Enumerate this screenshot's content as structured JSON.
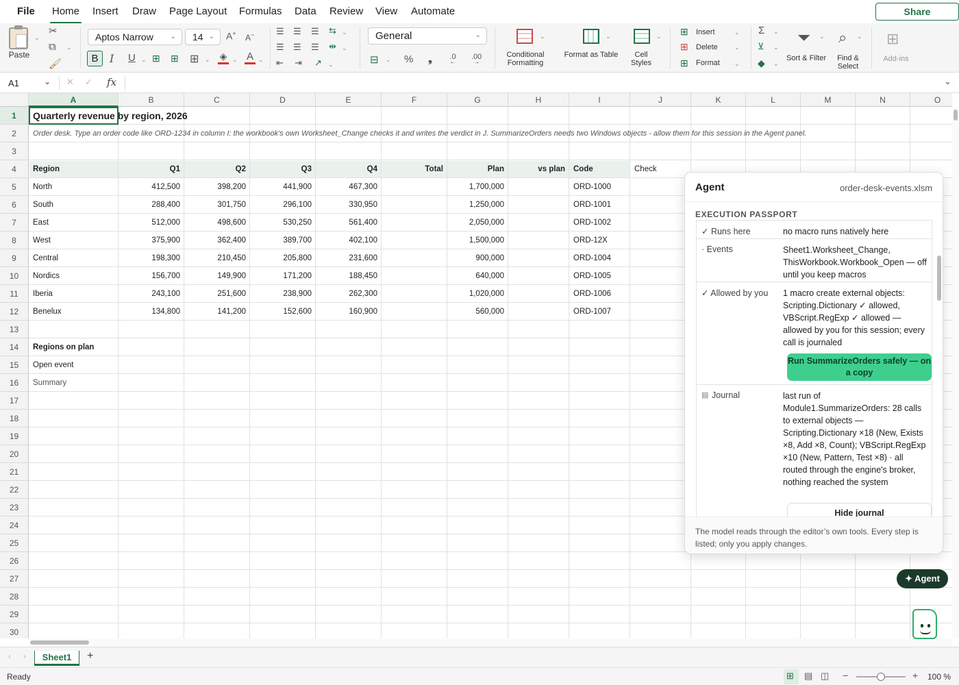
{
  "menu": {
    "file": "File",
    "tabs": [
      "Home",
      "Insert",
      "Draw",
      "Page Layout",
      "Formulas",
      "Data",
      "Review",
      "View",
      "Automate"
    ],
    "share": "Share"
  },
  "ribbon": {
    "paste": "Paste",
    "font_name": "Aptos Narrow",
    "font_size": "14",
    "number_format": "General",
    "conditional_formatting": "Conditional Formatting",
    "format_as_table": "Format as Table",
    "cell_styles": "Cell Styles",
    "insert": "Insert",
    "delete": "Delete",
    "format": "Format",
    "sort_filter": "Sort & Filter",
    "find_select": "Find & Select",
    "addins": "Add-ins",
    "bold": "B",
    "italic": "I",
    "underline": "U"
  },
  "formula_bar": {
    "name_box": "A1",
    "fx": "fx",
    "value": ""
  },
  "columns": [
    "A",
    "B",
    "C",
    "D",
    "E",
    "F",
    "G",
    "H",
    "I",
    "J",
    "K",
    "L",
    "M",
    "N",
    "O"
  ],
  "rows": [
    "1",
    "2",
    "3",
    "4",
    "5",
    "6",
    "7",
    "8",
    "9",
    "10",
    "11",
    "12",
    "13",
    "14",
    "15",
    "16",
    "17",
    "18",
    "19",
    "20",
    "21",
    "22",
    "23",
    "24",
    "25",
    "26",
    "27",
    "28",
    "29",
    "30"
  ],
  "sheet": {
    "title": "Quarterly revenue by region, 2026",
    "note": "Order desk. Type an order code like ORD-1234 in column I: the workbook's own Worksheet_Change checks it and writes the verdict in J. SummarizeOrders needs two Windows objects - allow them for this session in the Agent panel.",
    "headers": {
      "region": "Region",
      "q1": "Q1",
      "q2": "Q2",
      "q3": "Q3",
      "q4": "Q4",
      "total": "Total",
      "plan": "Plan",
      "vsplan": "vs plan",
      "code": "Code",
      "check": "Check"
    },
    "data": [
      {
        "region": "North",
        "q1": "412,500",
        "q2": "398,200",
        "q3": "441,900",
        "q4": "467,300",
        "plan": "1,700,000",
        "code": "ORD-1000"
      },
      {
        "region": "South",
        "q1": "288,400",
        "q2": "301,750",
        "q3": "296,100",
        "q4": "330,950",
        "plan": "1,250,000",
        "code": "ORD-1001"
      },
      {
        "region": "East",
        "q1": "512,000",
        "q2": "498,600",
        "q3": "530,250",
        "q4": "561,400",
        "plan": "2,050,000",
        "code": "ORD-1002"
      },
      {
        "region": "West",
        "q1": "375,900",
        "q2": "362,400",
        "q3": "389,700",
        "q4": "402,100",
        "plan": "1,500,000",
        "code": "ORD-12X"
      },
      {
        "region": "Central",
        "q1": "198,300",
        "q2": "210,450",
        "q3": "205,800",
        "q4": "231,600",
        "plan": "900,000",
        "code": "ORD-1004"
      },
      {
        "region": "Nordics",
        "q1": "156,700",
        "q2": "149,900",
        "q3": "171,200",
        "q4": "188,450",
        "plan": "640,000",
        "code": "ORD-1005"
      },
      {
        "region": "Iberia",
        "q1": "243,100",
        "q2": "251,600",
        "q3": "238,900",
        "q4": "262,300",
        "plan": "1,020,000",
        "code": "ORD-1006"
      },
      {
        "region": "Benelux",
        "q1": "134,800",
        "q2": "141,200",
        "q3": "152,600",
        "q4": "160,900",
        "plan": "560,000",
        "code": "ORD-1007"
      }
    ],
    "regions_on_plan": "Regions on plan",
    "open_event": "Open event",
    "summary": "Summary"
  },
  "agent": {
    "title": "Agent",
    "file": "order-desk-events.xlsm",
    "section": "EXECUTION PASSPORT",
    "runs_here_label": "✓ Runs here",
    "runs_here_value": "no macro runs natively here",
    "events_label": "· Events",
    "events_value": "Sheet1.Worksheet_Change, ThisWorkbook.Workbook_Open — off until you keep macros",
    "allowed_label": "✓ Allowed by you",
    "allowed_value": "1 macro create external objects: Scripting.Dictionary ✓ allowed, VBScript.RegExp ✓ allowed — allowed by you for this session; every call is journaled",
    "run_button": "Run SummarizeOrders safely — on a copy",
    "journal_label": "Journal",
    "journal_value": "last run of Module1.SummarizeOrders: 28 calls to external objects — Scripting.Dictionary ×18 (New, Exists ×8, Add ×8, Count); VBScript.RegExp ×10 (New, Pattern, Test ×8) · all routed through the engine's broker, nothing reached the system",
    "hide_journal": "Hide journal",
    "footer": "The model reads through the editor’s own tools. Every step is listed; only you apply changes.",
    "fab": "✦ Agent"
  },
  "tabs": {
    "sheet1": "Sheet1",
    "add": "+"
  },
  "status": {
    "ready": "Ready",
    "zoom": "100 %",
    "zoom_level": 0.5
  },
  "colors": {
    "accent": "#217346",
    "run_button": "#3ecf8e",
    "header_fill": "#e8f1ec"
  }
}
